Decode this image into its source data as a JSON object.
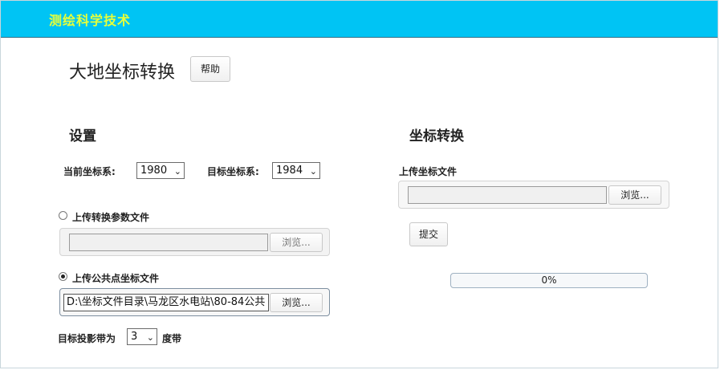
{
  "header": {
    "brand": "测绘科学技术",
    "accent_color": "#00c4f4",
    "brand_color": "#e6ff3b"
  },
  "page": {
    "title": "大地坐标转换",
    "help_label": "帮助"
  },
  "settings": {
    "title": "设置",
    "current_system_label": "当前坐标系:",
    "current_system_value": "1980",
    "target_system_label": "目标坐标系:",
    "target_system_value": "1984",
    "option_params": {
      "label": "上传转换参数文件",
      "checked": false,
      "file_value": "",
      "browse_label": "浏览..."
    },
    "option_common": {
      "label": "上传公共点坐标文件",
      "checked": true,
      "file_value": "D:\\坐标文件目录\\马龙区水电站\\80-84公共",
      "browse_label": "浏览..."
    },
    "projection_prefix": "目标投影带为",
    "projection_value": "3",
    "projection_suffix": "度带"
  },
  "convert": {
    "title": "坐标转换",
    "upload_label": "上传坐标文件",
    "file_value": "",
    "browse_label": "浏览...",
    "submit_label": "提交",
    "progress_percent": 0,
    "progress_text": "0%"
  },
  "icons": {
    "select_arrow": "chevron-down-icon",
    "radio": "radio-icon"
  }
}
